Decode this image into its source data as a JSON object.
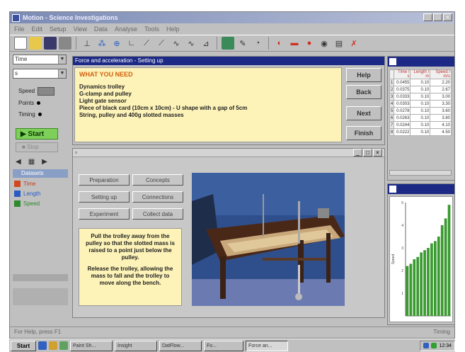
{
  "window": {
    "title": "Motion - Science Investigations"
  },
  "menu": [
    "File",
    "Edit",
    "Setup",
    "View",
    "Data",
    "Analyse",
    "Tools",
    "Help"
  ],
  "left_panel": {
    "select1": "Time",
    "select2": "s",
    "labels": {
      "speed": "Speed",
      "points": "Points",
      "timing": "Timing"
    },
    "start_label": "▶ Start",
    "stop_label": "■ Stop",
    "data_header": "Datasets",
    "data_items": [
      {
        "label": "Time",
        "color": "#d2481e"
      },
      {
        "label": "Length",
        "color": "#2a5bc4"
      },
      {
        "label": "Speed",
        "color": "#2e8a2e"
      }
    ]
  },
  "instructions": {
    "title": "Force and acceleration - Setting up",
    "heading": "WHAT YOU NEED",
    "lines": [
      "Dynamics trolley",
      "G-clamp and pulley",
      "Light gate sensor",
      "Piece of black card (10cm x 10cm) - U shape with a gap of 5cm",
      "String, pulley and 400g slotted masses"
    ],
    "nav": [
      "Help",
      "Back",
      "Next",
      "Finish"
    ]
  },
  "video": {
    "steps": [
      "Preparation",
      "Concepts",
      "Setting up",
      "Connections",
      "Experiment",
      "Collect data"
    ],
    "instr1": "Pull the trolley away from the pulley so that the slotted mass is raised to a point just below the pulley.",
    "instr2": "Release the trolley, allowing the mass to fall and the trolley to move along the bench."
  },
  "table": {
    "headers": [
      "",
      "Time / s",
      "Length / m",
      "Speed / m/s"
    ],
    "rows": [
      [
        "1",
        "0.0455",
        "0.10",
        "2.20"
      ],
      [
        "2",
        "0.0375",
        "0.10",
        "2.67"
      ],
      [
        "3",
        "0.0333",
        "0.10",
        "3.00"
      ],
      [
        "4",
        "0.0303",
        "0.10",
        "3.30"
      ],
      [
        "5",
        "0.0278",
        "0.10",
        "3.60"
      ],
      [
        "6",
        "0.0263",
        "0.10",
        "3.80"
      ],
      [
        "7",
        "0.0244",
        "0.10",
        "4.10"
      ],
      [
        "8",
        "0.0222",
        "0.10",
        "4.50"
      ]
    ]
  },
  "chart_data": {
    "type": "bar",
    "title": "",
    "xlabel": "",
    "ylabel": "Speed",
    "ylim": [
      0,
      5
    ],
    "yticks": [
      1,
      2,
      3,
      4,
      5
    ],
    "series": [
      {
        "values": [
          2.2,
          2.3,
          2.5,
          2.6,
          2.8,
          2.9,
          3.0,
          3.2,
          3.3,
          3.5,
          4.0,
          4.3,
          4.9
        ]
      }
    ],
    "bar_color": "#3a9a30"
  },
  "status": {
    "left": "For Help, press F1",
    "right": "Timing"
  },
  "taskbar": {
    "start": "Start",
    "tasks": [
      "Paint Sh...",
      "Insight",
      "DatFlow...",
      "Fo...",
      "Force an..."
    ],
    "clock": "12:34"
  }
}
